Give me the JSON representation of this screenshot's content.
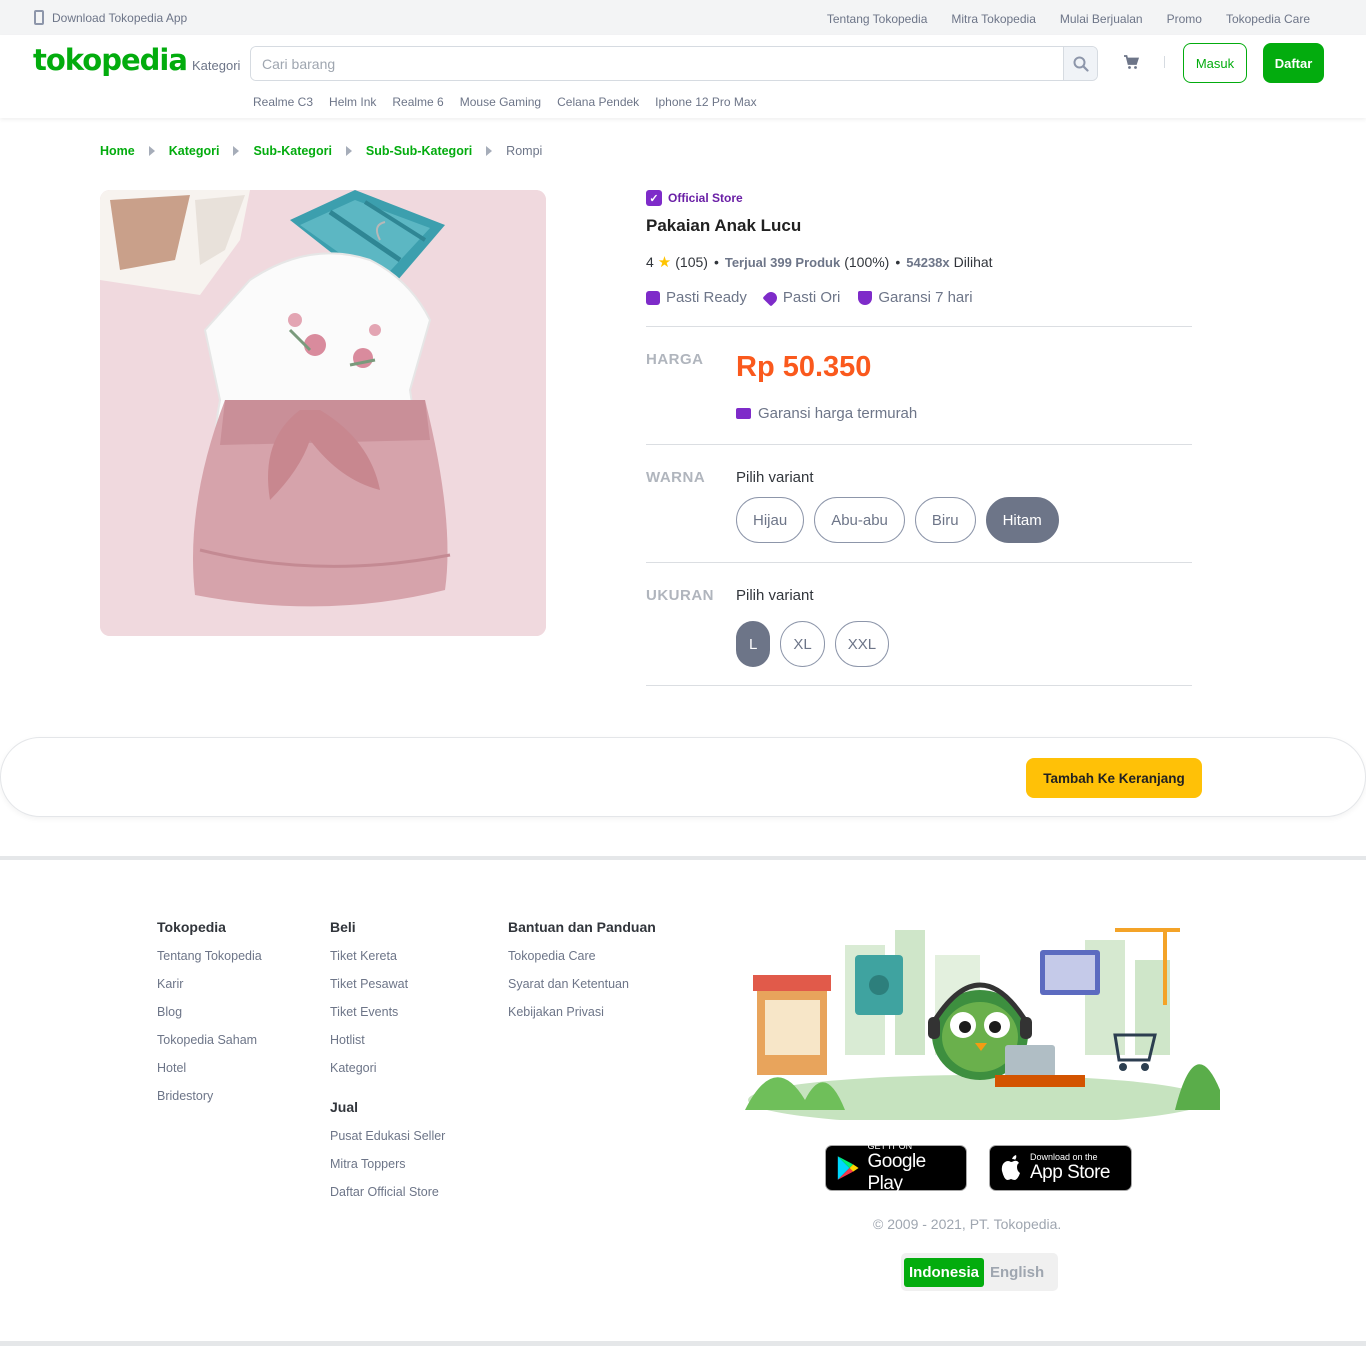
{
  "topbar": {
    "download_app": "Download Tokopedia App",
    "links": [
      "Tentang Tokopedia",
      "Mitra Tokopedia",
      "Mulai Berjualan",
      "Promo",
      "Tokopedia Care"
    ]
  },
  "header": {
    "logo": "tokopedia",
    "kategori": "Kategori",
    "search_placeholder": "Cari barang",
    "login_label": "Masuk",
    "register_label": "Daftar",
    "keywords": [
      "Realme C3",
      "Helm Ink",
      "Realme 6",
      "Mouse Gaming",
      "Celana Pendek",
      "Iphone 12 Pro Max"
    ]
  },
  "breadcrumb": [
    "Home",
    "Kategori",
    "Sub-Kategori",
    "Sub-Sub-Kategori"
  ],
  "breadcrumb_current": "Rompi",
  "product": {
    "badge": "Official Store",
    "title": "Pakaian Anak Lucu",
    "rating": "4",
    "reviews": "(105)",
    "sold_label": "Terjual 399 Produk",
    "sold_pct": "(100%)",
    "views_count": "54238x",
    "views_label": "Dilihat",
    "features": [
      "Pasti Ready",
      "Pasti Ori",
      "Garansi 7 hari"
    ],
    "price_label": "HARGA",
    "price": "Rp 50.350",
    "price_guarantee": "Garansi harga termurah",
    "color_label": "WARNA",
    "color_prompt": "Pilih variant",
    "colors": [
      "Hijau",
      "Abu-abu",
      "Biru",
      "Hitam"
    ],
    "color_selected": "Hitam",
    "size_label": "UKURAN",
    "size_prompt": "Pilih variant",
    "sizes": [
      "L",
      "XL",
      "XXL"
    ],
    "size_selected": "L",
    "add_to_cart": "Tambah Ke Keranjang"
  },
  "footer": {
    "col1": {
      "title": "Tokopedia",
      "links": [
        "Tentang Tokopedia",
        "Karir",
        "Blog",
        "Tokopedia Saham",
        "Hotel",
        "Bridestory"
      ]
    },
    "col2": {
      "title": "Beli",
      "links": [
        "Tiket Kereta",
        "Tiket Pesawat",
        "Tiket Events",
        "Hotlist",
        "Kategori"
      ]
    },
    "col2b": {
      "title": "Jual",
      "links": [
        "Pusat Edukasi Seller",
        "Mitra Toppers",
        "Daftar Official Store"
      ]
    },
    "col3": {
      "title": "Bantuan dan Panduan",
      "links": [
        "Tokopedia Care",
        "Syarat dan Ketentuan",
        "Kebijakan Privasi"
      ]
    },
    "google_play_small": "GET IT ON",
    "google_play_big": "Google Play",
    "app_store_small": "Download on the",
    "app_store_big": "App Store",
    "copyright": "© 2009 - 2021, PT. Tokopedia.",
    "lang_active": "Indonesia",
    "lang_inactive": "English"
  },
  "colors": {
    "brand": "#03ac0e",
    "price": "#fa591d",
    "official": "#7e2bc9",
    "cart_button": "#ffc107"
  }
}
